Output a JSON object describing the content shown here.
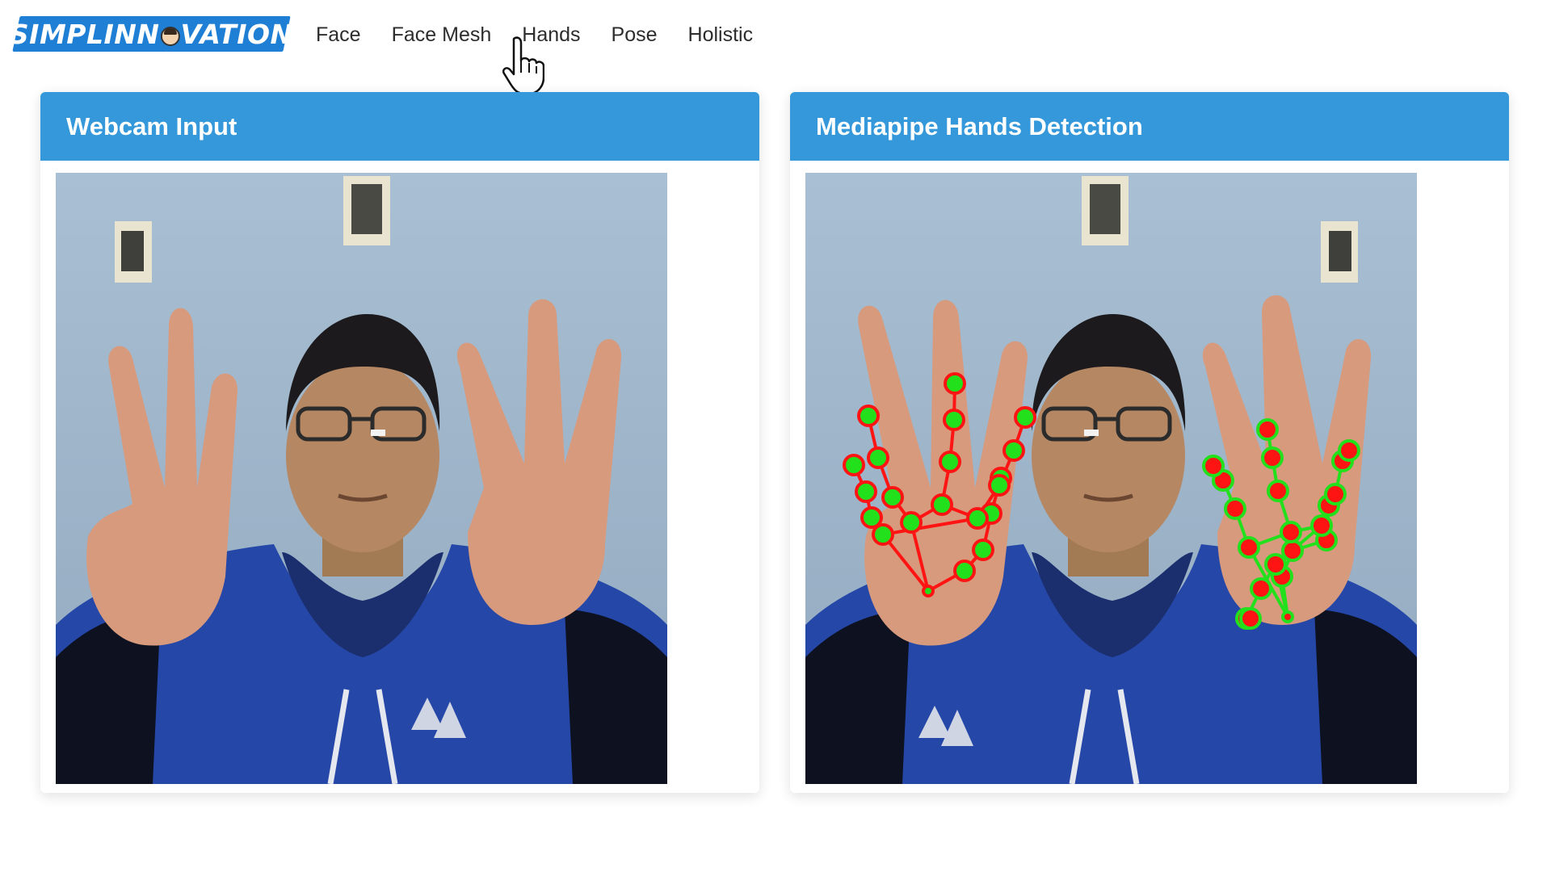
{
  "brand": {
    "text_before": "SIMPLINN",
    "text_after": "VATION"
  },
  "nav": {
    "items": [
      {
        "label": "Face",
        "name": "nav-face"
      },
      {
        "label": "Face Mesh",
        "name": "nav-face-mesh"
      },
      {
        "label": "Hands",
        "name": "nav-hands"
      },
      {
        "label": "Pose",
        "name": "nav-pose"
      },
      {
        "label": "Holistic",
        "name": "nav-holistic"
      }
    ]
  },
  "panels": {
    "input": {
      "title": "Webcam Input"
    },
    "output": {
      "title": "Mediapipe Hands Detection"
    }
  },
  "colors": {
    "brand": "#1f7fd4",
    "header": "#3498db",
    "landmark_green": "#22e01c",
    "landmark_red": "#ff1414"
  }
}
